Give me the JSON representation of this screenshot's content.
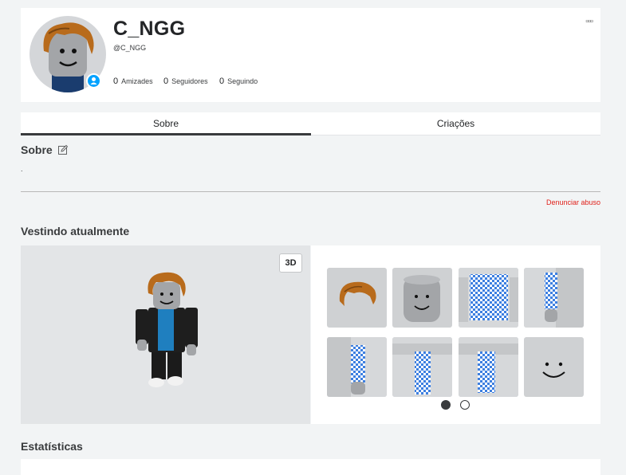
{
  "profile": {
    "display_name": "C_NGG",
    "username": "@C_NGG",
    "friends_count": "0",
    "friends_label": "Amizades",
    "followers_count": "0",
    "followers_label": "Seguidores",
    "following_count": "0",
    "following_label": "Seguindo",
    "more_menu": "▫▫▫"
  },
  "tabs": [
    {
      "label": "Sobre",
      "active": true
    },
    {
      "label": "Criações",
      "active": false
    }
  ],
  "about": {
    "title": "Sobre",
    "text": ".",
    "report_label": "Denunciar abuso"
  },
  "wearing": {
    "title": "Vestindo atualmente",
    "toggle_3d_label": "3D",
    "items": [
      {
        "icon": "hair-accessory-icon"
      },
      {
        "icon": "head-icon"
      },
      {
        "icon": "checkered-shirt-icon"
      },
      {
        "icon": "checkered-right-arm-icon"
      },
      {
        "icon": "checkered-left-arm-icon"
      },
      {
        "icon": "checkered-left-leg-icon"
      },
      {
        "icon": "checkered-right-leg-icon"
      },
      {
        "icon": "smile-face-icon"
      }
    ],
    "pager": {
      "pages": 2,
      "current": 1
    }
  },
  "stats": {
    "title": "Estatísticas"
  },
  "colors": {
    "accent": "#00a2ff",
    "danger": "#e0211b",
    "checker": "#3d7fe0"
  }
}
